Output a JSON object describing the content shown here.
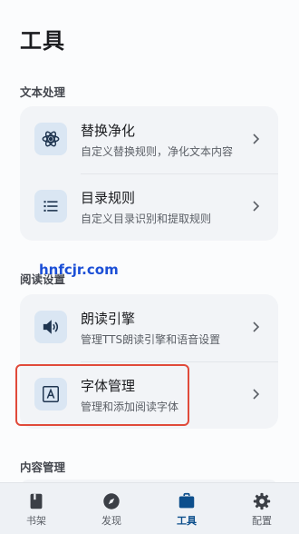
{
  "page_title": "工具",
  "sections": {
    "text_processing": {
      "title": "文本处理",
      "items": [
        {
          "title": "替换净化",
          "desc": "自定义替换规则，净化文本内容",
          "icon": "atom-icon"
        },
        {
          "title": "目录规则",
          "desc": "自定义目录识别和提取规则",
          "icon": "list-icon"
        }
      ]
    },
    "reading_settings": {
      "title": "阅读设置",
      "items": [
        {
          "title": "朗读引擎",
          "desc": "管理TTS朗读引擎和语音设置",
          "icon": "speaker-icon"
        },
        {
          "title": "字体管理",
          "desc": "管理和添加阅读字体",
          "icon": "font-icon"
        }
      ]
    },
    "content_management": {
      "title": "内容管理"
    }
  },
  "watermark": "hnfcjr.com",
  "bottom_nav": {
    "items": [
      {
        "label": "书架",
        "icon": "bookshelf-icon",
        "active": false
      },
      {
        "label": "发现",
        "icon": "compass-icon",
        "active": false
      },
      {
        "label": "工具",
        "icon": "toolbox-icon",
        "active": true
      },
      {
        "label": "配置",
        "icon": "gear-icon",
        "active": false
      }
    ]
  },
  "colors": {
    "accent": "#0d4f8c",
    "highlight_border": "#e04a3a",
    "card_bg": "#f2f4f7",
    "icon_bg": "#dae6f3"
  }
}
